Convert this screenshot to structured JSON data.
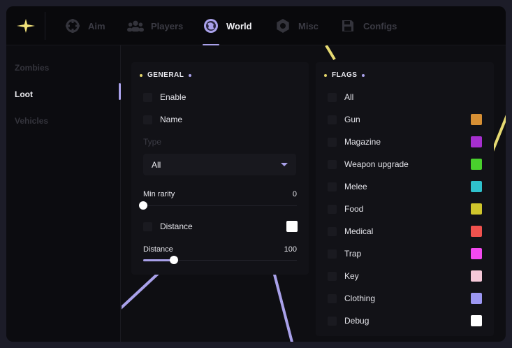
{
  "tabs": [
    {
      "label": "Aim",
      "icon": "crosshair-icon"
    },
    {
      "label": "Players",
      "icon": "players-icon"
    },
    {
      "label": "World",
      "icon": "globe-icon",
      "active": true
    },
    {
      "label": "Misc",
      "icon": "gear-icon"
    },
    {
      "label": "Configs",
      "icon": "save-icon"
    }
  ],
  "sidebar": {
    "items": [
      {
        "label": "Zombies"
      },
      {
        "label": "Loot",
        "active": true
      },
      {
        "label": "Vehicles"
      }
    ]
  },
  "general": {
    "title": "GENERAL",
    "enable_label": "Enable",
    "name_label": "Name",
    "type_label": "Type",
    "type_value": "All",
    "min_rarity": {
      "label": "Min rarity",
      "value": "0",
      "fraction": 0
    },
    "distance_toggle_label": "Distance",
    "distance_color": "#ffffff",
    "distance": {
      "label": "Distance",
      "value": "100",
      "fraction": 0.2
    }
  },
  "flags": {
    "title": "FLAGS",
    "items": [
      {
        "label": "All",
        "color": null
      },
      {
        "label": "Gun",
        "color": "#d68f34"
      },
      {
        "label": "Magazine",
        "color": "#a62fcf"
      },
      {
        "label": "Weapon upgrade",
        "color": "#49cf2d"
      },
      {
        "label": "Melee",
        "color": "#2fc1cc"
      },
      {
        "label": "Food",
        "color": "#cfc52c"
      },
      {
        "label": "Medical",
        "color": "#f0524e"
      },
      {
        "label": "Trap",
        "color": "#f349f0"
      },
      {
        "label": "Key",
        "color": "#f6c9d9"
      },
      {
        "label": "Clothing",
        "color": "#9c97f2"
      },
      {
        "label": "Debug",
        "color": "#ffffff"
      }
    ]
  },
  "colors": {
    "accent": "#a9a1ea",
    "logo": "#f2e27a"
  }
}
